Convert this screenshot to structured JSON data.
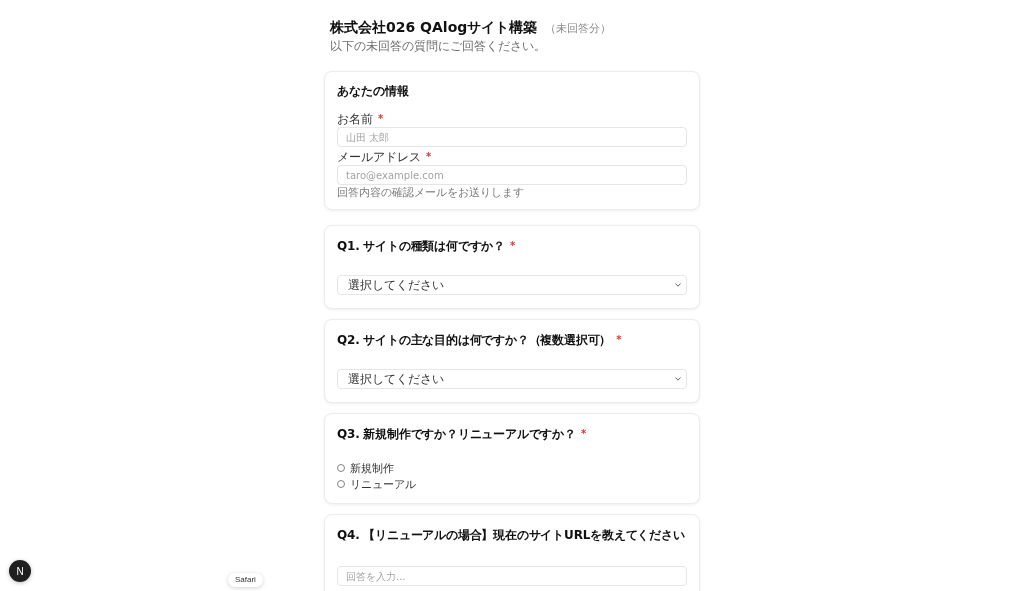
{
  "header": {
    "title": "株式会社026 QAlogサイト構築",
    "status": "（未回答分）",
    "subtitle": "以下の未回答の質問にご回答ください。"
  },
  "sections": [
    {
      "kind": "info",
      "title": "あなたの情報",
      "fields": [
        {
          "label": "お名前",
          "required_mark": "*",
          "placeholder": "山田 太郎"
        },
        {
          "label": "メールアドレス",
          "required_mark": "*",
          "placeholder": "taro@example.com",
          "hint": "回答内容の確認メールをお送りします"
        }
      ]
    },
    {
      "kind": "select",
      "question": "Q1. サイトの種類は何ですか？",
      "required_mark": "*",
      "value": "選択してください"
    },
    {
      "kind": "select",
      "question": "Q2. サイトの主な目的は何ですか？（複数選択可）",
      "required_mark": "*",
      "value": "選択してください"
    },
    {
      "kind": "radio",
      "question": "Q3. 新規制作ですか？リニューアルですか？",
      "required_mark": "*",
      "options": [
        {
          "label": "新規制作",
          "selected": false
        },
        {
          "label": "リニューアル",
          "selected": false
        }
      ]
    },
    {
      "kind": "text",
      "question": "Q4. 【リニューアルの場合】現在のサイトURLを教えてください",
      "placeholder": "回答を入力..."
    }
  ],
  "dev_indicator": {
    "label": "N"
  },
  "tooltip": {
    "label": "Safari"
  }
}
